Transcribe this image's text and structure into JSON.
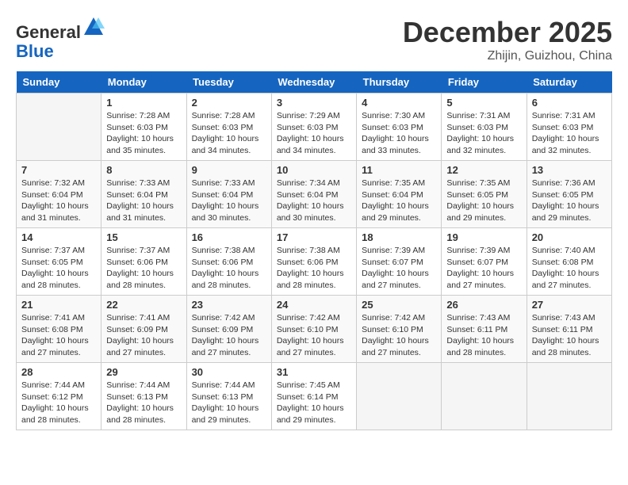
{
  "header": {
    "logo_general": "General",
    "logo_blue": "Blue",
    "month_title": "December 2025",
    "subtitle": "Zhijin, Guizhou, China"
  },
  "weekdays": [
    "Sunday",
    "Monday",
    "Tuesday",
    "Wednesday",
    "Thursday",
    "Friday",
    "Saturday"
  ],
  "weeks": [
    [
      {
        "day": "",
        "info": ""
      },
      {
        "day": "1",
        "info": "Sunrise: 7:28 AM\nSunset: 6:03 PM\nDaylight: 10 hours\nand 35 minutes."
      },
      {
        "day": "2",
        "info": "Sunrise: 7:28 AM\nSunset: 6:03 PM\nDaylight: 10 hours\nand 34 minutes."
      },
      {
        "day": "3",
        "info": "Sunrise: 7:29 AM\nSunset: 6:03 PM\nDaylight: 10 hours\nand 34 minutes."
      },
      {
        "day": "4",
        "info": "Sunrise: 7:30 AM\nSunset: 6:03 PM\nDaylight: 10 hours\nand 33 minutes."
      },
      {
        "day": "5",
        "info": "Sunrise: 7:31 AM\nSunset: 6:03 PM\nDaylight: 10 hours\nand 32 minutes."
      },
      {
        "day": "6",
        "info": "Sunrise: 7:31 AM\nSunset: 6:03 PM\nDaylight: 10 hours\nand 32 minutes."
      }
    ],
    [
      {
        "day": "7",
        "info": "Sunrise: 7:32 AM\nSunset: 6:04 PM\nDaylight: 10 hours\nand 31 minutes."
      },
      {
        "day": "8",
        "info": "Sunrise: 7:33 AM\nSunset: 6:04 PM\nDaylight: 10 hours\nand 31 minutes."
      },
      {
        "day": "9",
        "info": "Sunrise: 7:33 AM\nSunset: 6:04 PM\nDaylight: 10 hours\nand 30 minutes."
      },
      {
        "day": "10",
        "info": "Sunrise: 7:34 AM\nSunset: 6:04 PM\nDaylight: 10 hours\nand 30 minutes."
      },
      {
        "day": "11",
        "info": "Sunrise: 7:35 AM\nSunset: 6:04 PM\nDaylight: 10 hours\nand 29 minutes."
      },
      {
        "day": "12",
        "info": "Sunrise: 7:35 AM\nSunset: 6:05 PM\nDaylight: 10 hours\nand 29 minutes."
      },
      {
        "day": "13",
        "info": "Sunrise: 7:36 AM\nSunset: 6:05 PM\nDaylight: 10 hours\nand 29 minutes."
      }
    ],
    [
      {
        "day": "14",
        "info": "Sunrise: 7:37 AM\nSunset: 6:05 PM\nDaylight: 10 hours\nand 28 minutes."
      },
      {
        "day": "15",
        "info": "Sunrise: 7:37 AM\nSunset: 6:06 PM\nDaylight: 10 hours\nand 28 minutes."
      },
      {
        "day": "16",
        "info": "Sunrise: 7:38 AM\nSunset: 6:06 PM\nDaylight: 10 hours\nand 28 minutes."
      },
      {
        "day": "17",
        "info": "Sunrise: 7:38 AM\nSunset: 6:06 PM\nDaylight: 10 hours\nand 28 minutes."
      },
      {
        "day": "18",
        "info": "Sunrise: 7:39 AM\nSunset: 6:07 PM\nDaylight: 10 hours\nand 27 minutes."
      },
      {
        "day": "19",
        "info": "Sunrise: 7:39 AM\nSunset: 6:07 PM\nDaylight: 10 hours\nand 27 minutes."
      },
      {
        "day": "20",
        "info": "Sunrise: 7:40 AM\nSunset: 6:08 PM\nDaylight: 10 hours\nand 27 minutes."
      }
    ],
    [
      {
        "day": "21",
        "info": "Sunrise: 7:41 AM\nSunset: 6:08 PM\nDaylight: 10 hours\nand 27 minutes."
      },
      {
        "day": "22",
        "info": "Sunrise: 7:41 AM\nSunset: 6:09 PM\nDaylight: 10 hours\nand 27 minutes."
      },
      {
        "day": "23",
        "info": "Sunrise: 7:42 AM\nSunset: 6:09 PM\nDaylight: 10 hours\nand 27 minutes."
      },
      {
        "day": "24",
        "info": "Sunrise: 7:42 AM\nSunset: 6:10 PM\nDaylight: 10 hours\nand 27 minutes."
      },
      {
        "day": "25",
        "info": "Sunrise: 7:42 AM\nSunset: 6:10 PM\nDaylight: 10 hours\nand 27 minutes."
      },
      {
        "day": "26",
        "info": "Sunrise: 7:43 AM\nSunset: 6:11 PM\nDaylight: 10 hours\nand 28 minutes."
      },
      {
        "day": "27",
        "info": "Sunrise: 7:43 AM\nSunset: 6:11 PM\nDaylight: 10 hours\nand 28 minutes."
      }
    ],
    [
      {
        "day": "28",
        "info": "Sunrise: 7:44 AM\nSunset: 6:12 PM\nDaylight: 10 hours\nand 28 minutes."
      },
      {
        "day": "29",
        "info": "Sunrise: 7:44 AM\nSunset: 6:13 PM\nDaylight: 10 hours\nand 28 minutes."
      },
      {
        "day": "30",
        "info": "Sunrise: 7:44 AM\nSunset: 6:13 PM\nDaylight: 10 hours\nand 29 minutes."
      },
      {
        "day": "31",
        "info": "Sunrise: 7:45 AM\nSunset: 6:14 PM\nDaylight: 10 hours\nand 29 minutes."
      },
      {
        "day": "",
        "info": ""
      },
      {
        "day": "",
        "info": ""
      },
      {
        "day": "",
        "info": ""
      }
    ]
  ]
}
